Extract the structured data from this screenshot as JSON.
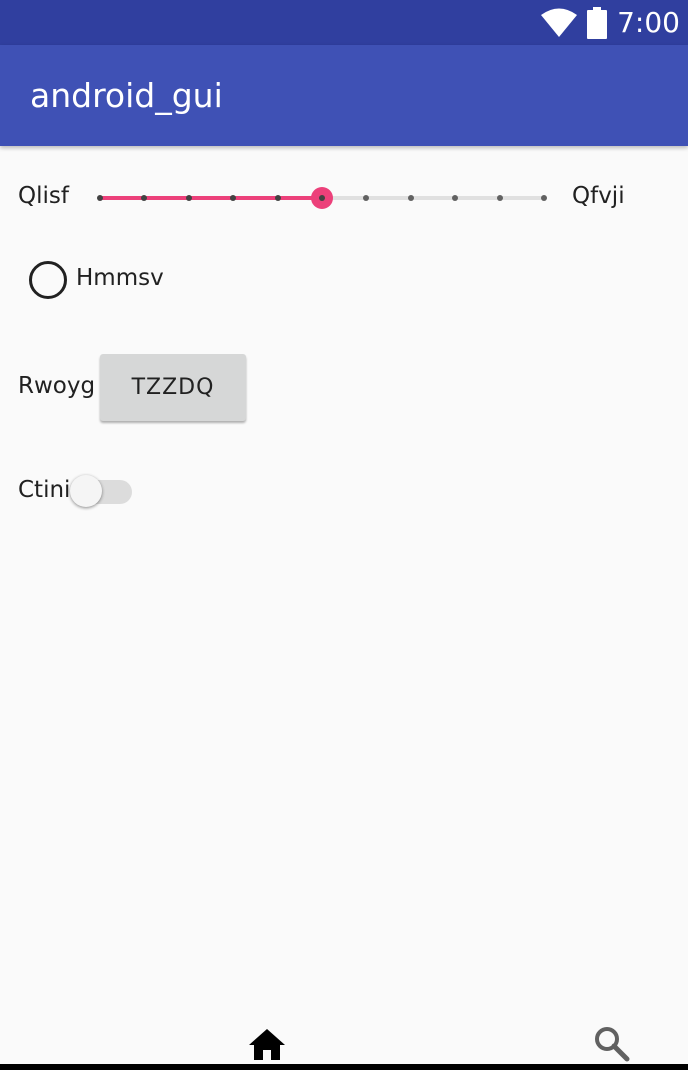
{
  "status_bar": {
    "time": "7:00",
    "icons": [
      "wifi-icon",
      "battery-icon"
    ],
    "background": "#303f9f"
  },
  "app_bar": {
    "title": "android_gui",
    "background": "#3f51b5"
  },
  "content": {
    "slider": {
      "left_label": "Qlisf",
      "right_label": "Qfvji",
      "steps": 11,
      "value_step": 5,
      "accent": "#ec407a"
    },
    "radio": {
      "label": "Hmmsv",
      "checked": false
    },
    "button_row": {
      "label": "Rwoyg",
      "button_text": "TZZDQ"
    },
    "switch": {
      "label": "Ctini",
      "on": false
    }
  },
  "bottom_nav": {
    "items": [
      {
        "icon": "home-icon"
      },
      {
        "icon": "search-icon"
      }
    ]
  }
}
